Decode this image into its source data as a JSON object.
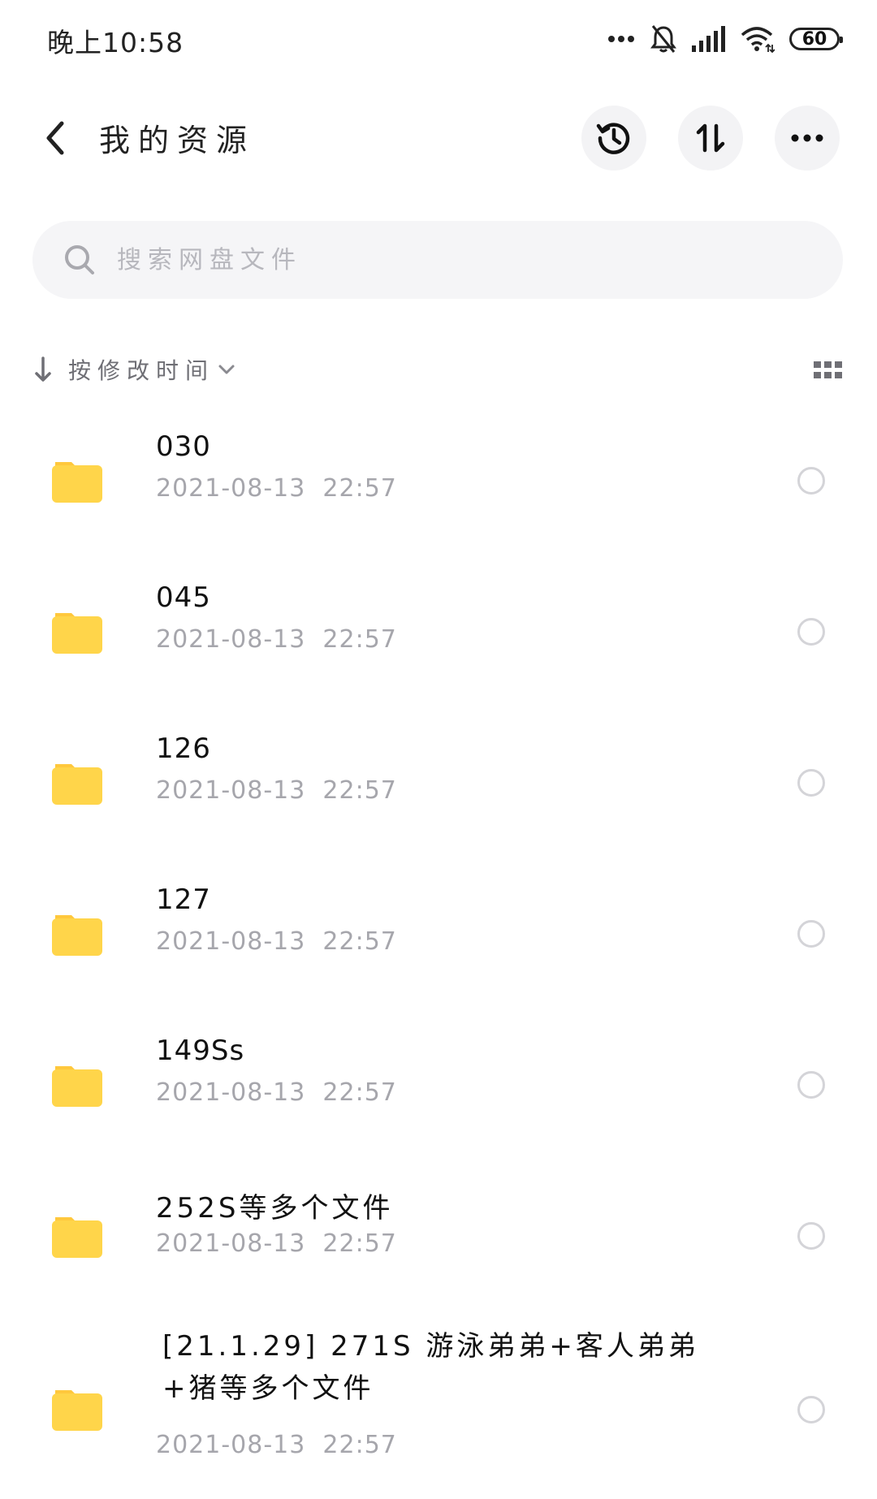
{
  "status_bar": {
    "time": "晚上10:58",
    "battery": "60"
  },
  "header": {
    "title": "我的资源"
  },
  "search": {
    "placeholder": "搜索网盘文件"
  },
  "sort": {
    "label": "按修改时间"
  },
  "files": [
    {
      "name": "030",
      "date": "2021-08-13  22:57"
    },
    {
      "name": "045",
      "date": "2021-08-13  22:57"
    },
    {
      "name": "126",
      "date": "2021-08-13  22:57"
    },
    {
      "name": "127",
      "date": "2021-08-13  22:57"
    },
    {
      "name": "149Ss",
      "date": "2021-08-13  22:57"
    },
    {
      "name": "252S等多个文件",
      "date": "2021-08-13  22:57"
    },
    {
      "name": "[21.1.29] 271S 游泳弟弟+客人弟弟+猪等多个文件",
      "date": "2021-08-13  22:57"
    }
  ],
  "colors": {
    "folder": "#FFD54A",
    "folder_tab": "#FFC83D",
    "button_bg": "#F3F3F5",
    "search_bg": "#F5F5F7",
    "muted_text": "#A6A6AC"
  }
}
